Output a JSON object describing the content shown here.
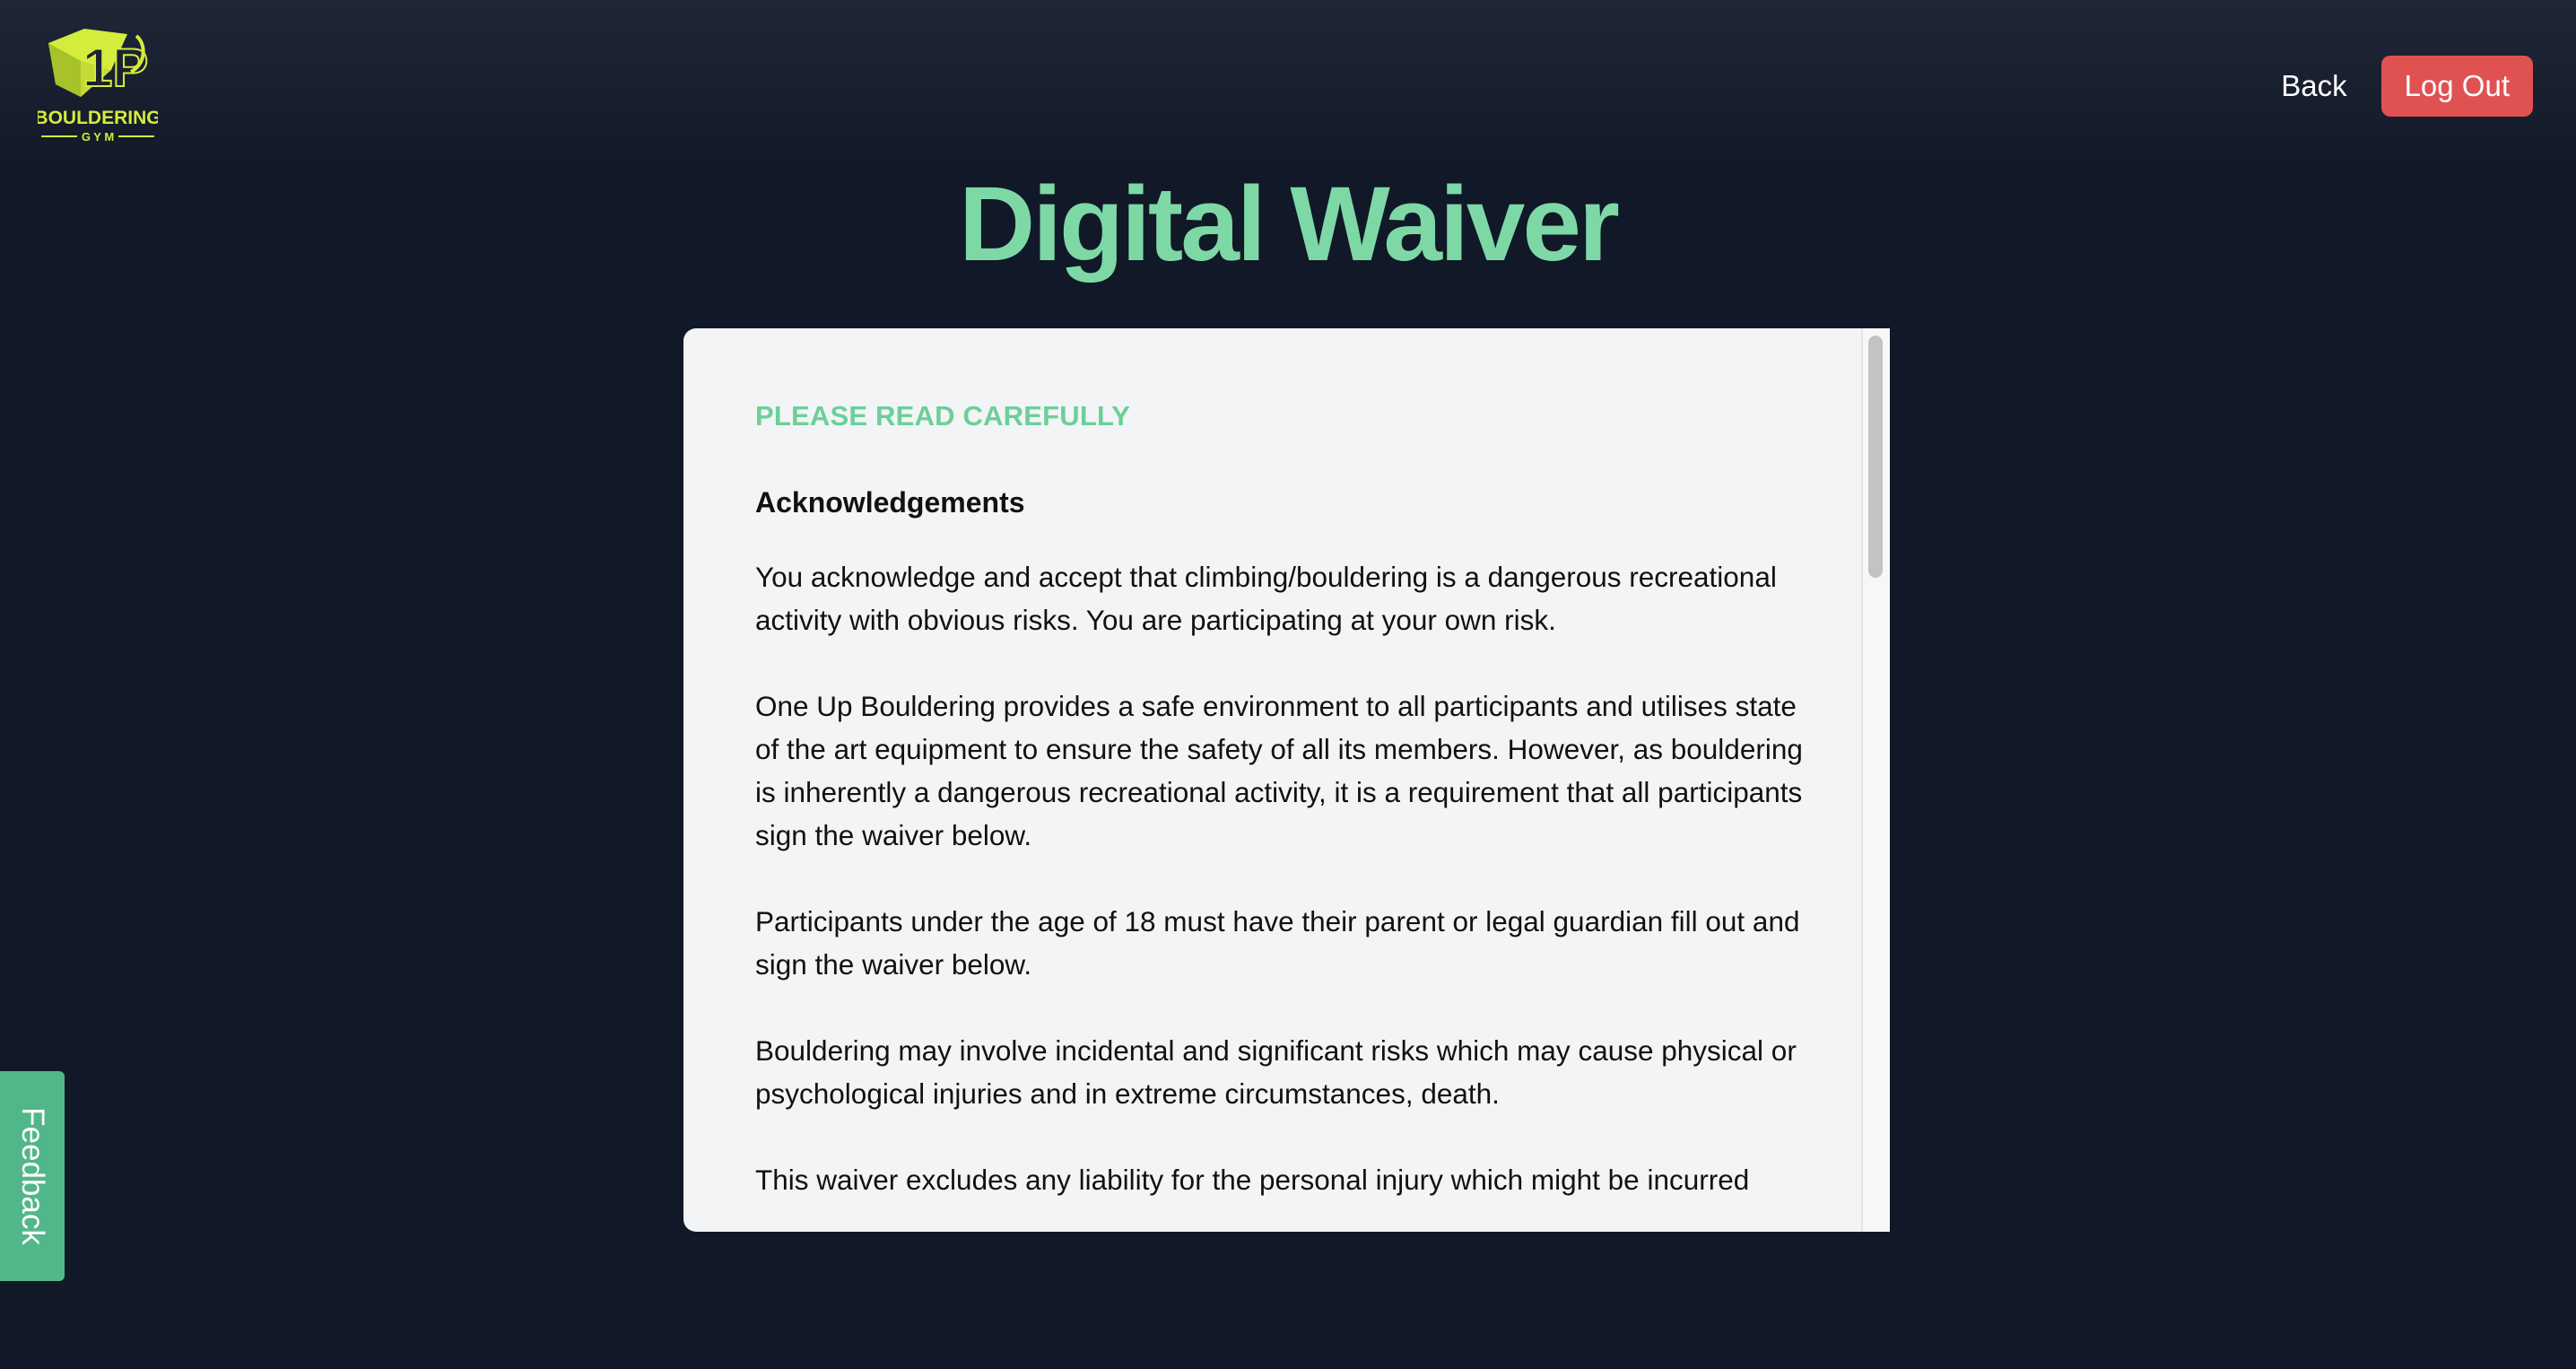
{
  "brand": {
    "logo_mark": "1P",
    "logo_text": "BOULDERING",
    "logo_subtext": "G Y M",
    "accent_color": "#d4ec3c"
  },
  "header": {
    "back_label": "Back",
    "logout_label": "Log Out"
  },
  "page_title": "Digital Waiver",
  "waiver": {
    "heading": "PLEASE READ CAREFULLY",
    "subheading": "Acknowledgements",
    "paragraphs": [
      "You acknowledge and accept that climbing/bouldering is a dangerous recreational activity with obvious risks. You are participating at your own risk.",
      "One Up Bouldering provides a safe environment to all participants and utilises state of the art equipment to ensure the safety of all its members. However, as bouldering is inherently a dangerous recreational activity, it is a requirement that all participants sign the waiver below.",
      "Participants under the age of 18 must have their parent or legal guardian fill out and sign the waiver below.",
      "Bouldering may involve incidental and significant risks which may cause physical or psychological injuries and in extreme circumstances, death.",
      "This waiver excludes any liability for the personal injury which might be incurred"
    ]
  },
  "feedback": {
    "label": "Feedback"
  },
  "colors": {
    "background": "#111827",
    "title": "#7dd8a6",
    "logout": "#e05252",
    "feedback": "#52b788"
  }
}
